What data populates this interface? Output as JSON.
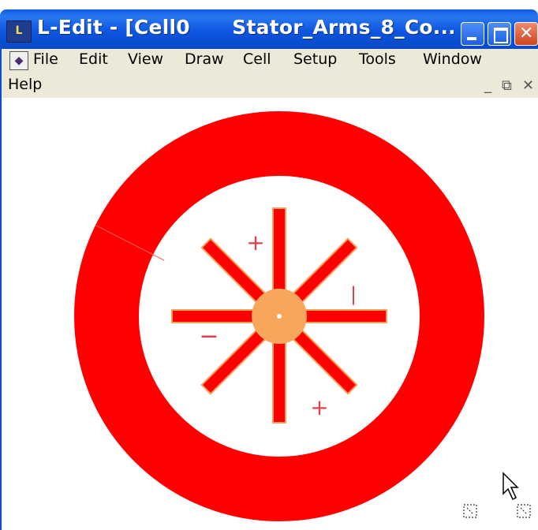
{
  "window": {
    "title": "L-Edit - [Cell0      Stator_Arms_8_Co...",
    "app_icon_label": "L"
  },
  "menu": {
    "items": [
      "File",
      "Edit",
      "View",
      "Draw",
      "Cell",
      "Setup",
      "Tools",
      "Window"
    ],
    "help": "Help"
  },
  "canvas": {
    "labels": {
      "plus_top": "+",
      "minus_left": "−",
      "bar_right": "|",
      "plus_bottom": "+"
    }
  },
  "colors": {
    "ring": "#ff0000",
    "arm": "#ff0000",
    "arm_outline": "#f3a25a",
    "hub": "#f7a65c",
    "titlebar": "#0a5ce8",
    "menubar": "#ece9d8"
  },
  "icons": [
    "app-icon",
    "document-icon",
    "minimize-icon",
    "maximize-icon",
    "close-icon",
    "restore-icon",
    "mouse-cursor-icon",
    "snap-corner-icon"
  ]
}
